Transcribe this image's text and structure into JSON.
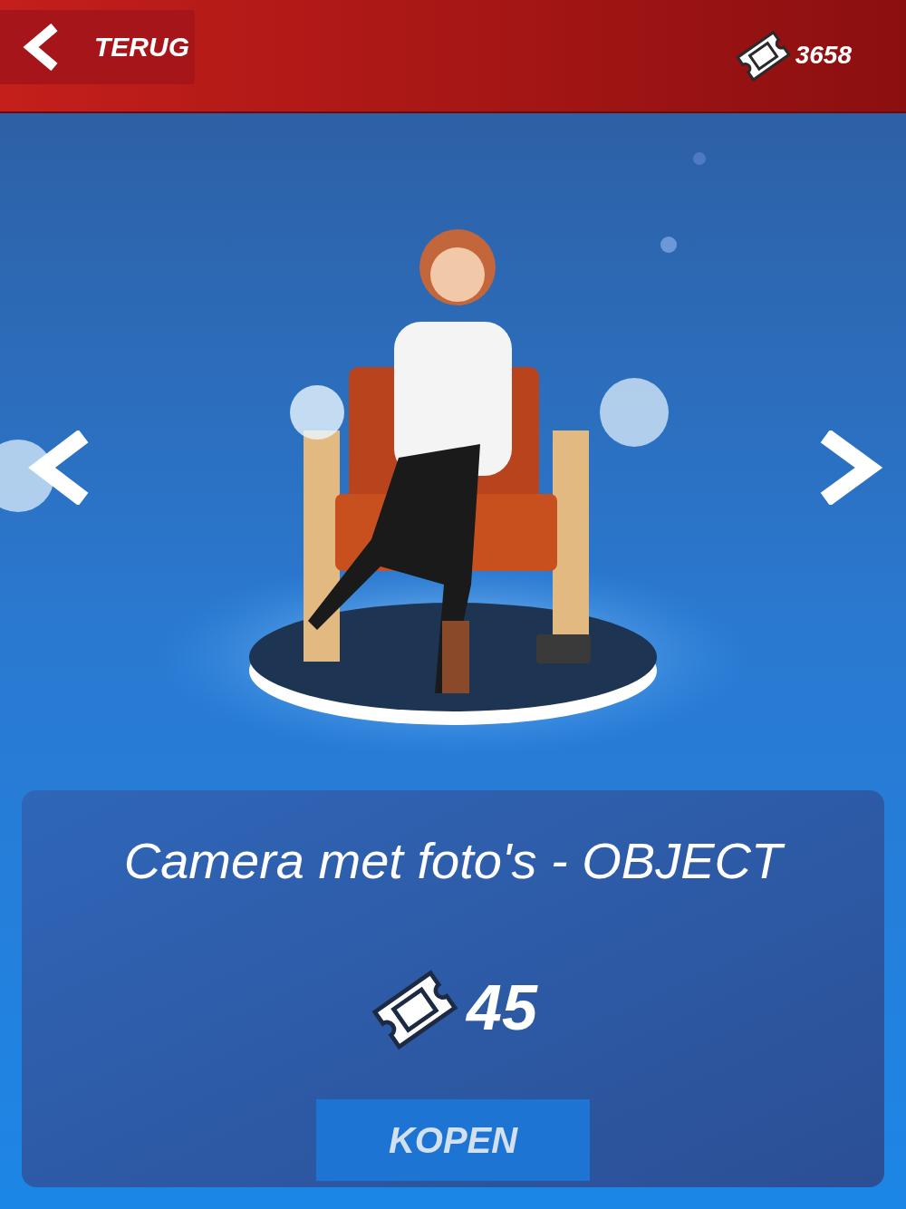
{
  "header": {
    "back_button": {
      "label": "TERUG"
    },
    "balance": "3658"
  },
  "item": {
    "title": "Camera met foto's - OBJECT",
    "price": "45",
    "buy_button": {
      "label": "KOPEN"
    }
  }
}
